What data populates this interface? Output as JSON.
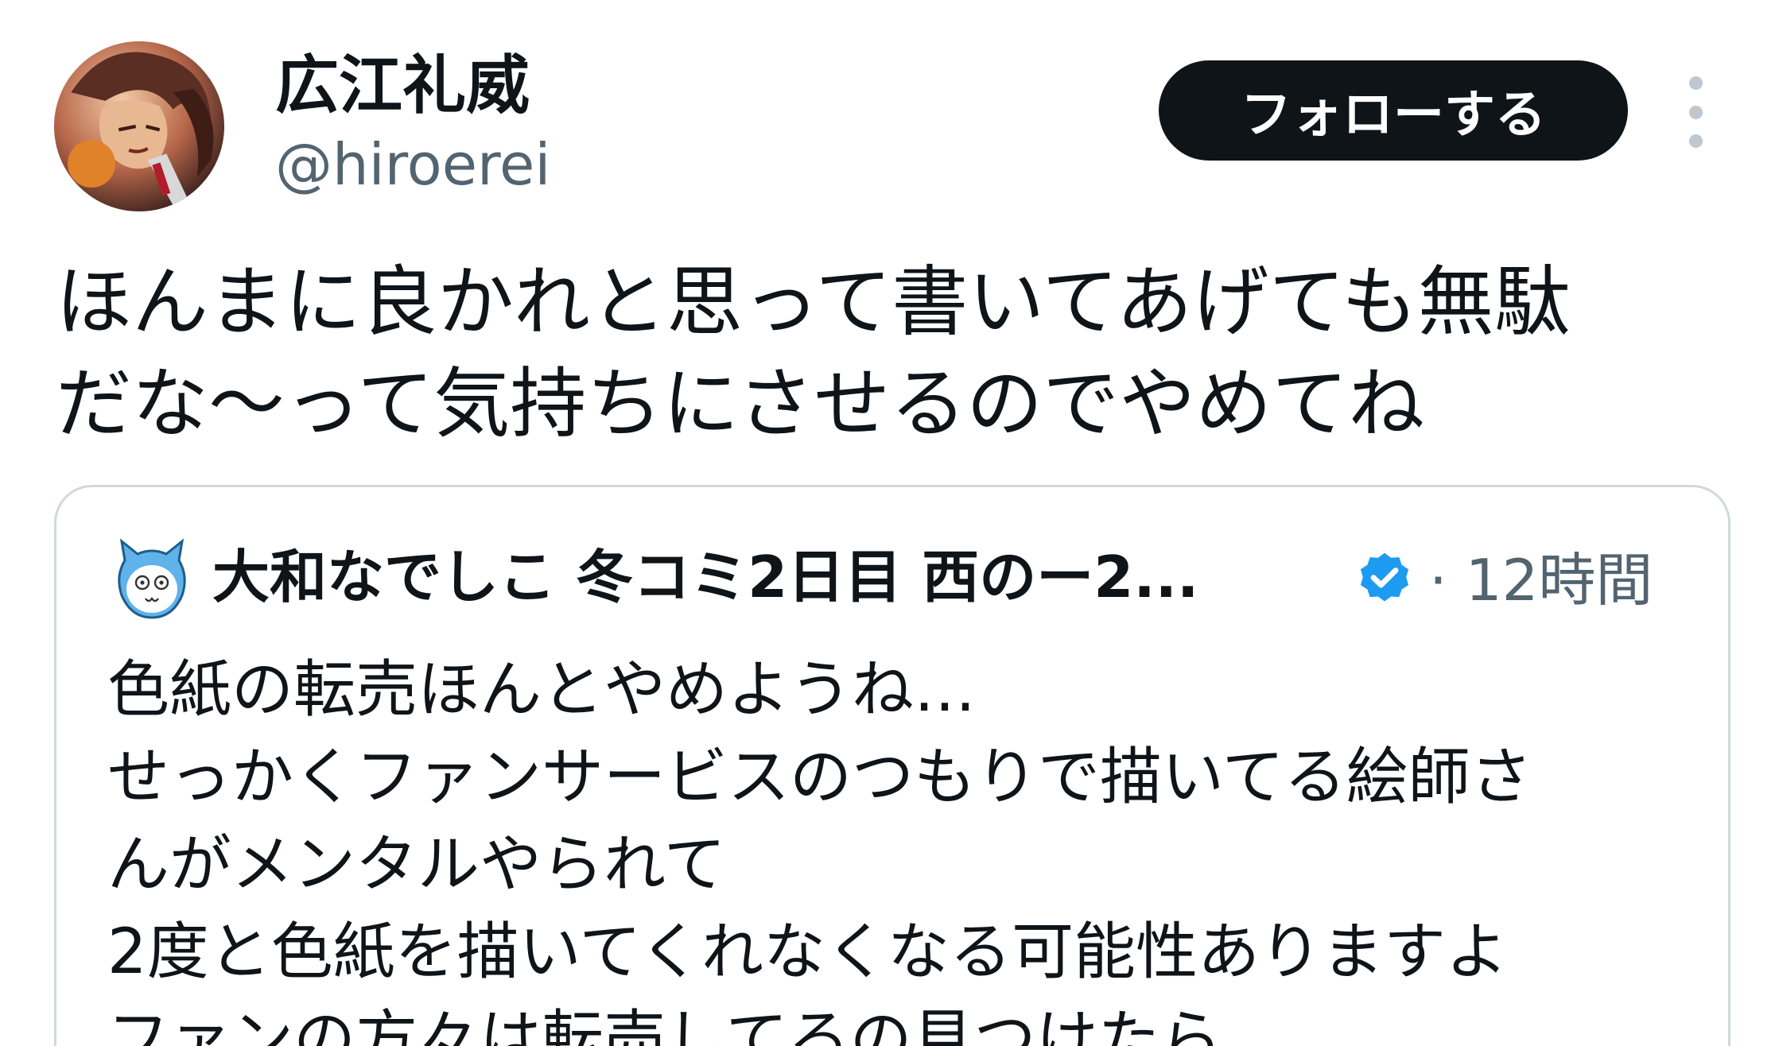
{
  "author": {
    "display_name": "広江礼威",
    "handle": "@hiroerei"
  },
  "actions": {
    "follow_label": "フォローする"
  },
  "tweet": {
    "lines": [
      "ほんまに良かれと思って書いてあげても無駄",
      "だな〜って気持ちにさせるのでやめてね"
    ]
  },
  "quoted_tweet": {
    "display_name": "大和なでしこ 冬コミ2日目 西のー2...",
    "time": "· 12時間",
    "verified": true,
    "lines": [
      "色紙の転売ほんとやめようね…",
      "せっかくファンサービスのつもりで描いてる絵師さ",
      "んがメンタルやられて",
      "2度と色紙を描いてくれなくなる可能性ありますよ",
      "ファンの方々は転売してるの見つけたら"
    ]
  },
  "colors": {
    "text_primary": "#0f1419",
    "text_secondary": "#536471",
    "border": "#cfd9de",
    "verified_blue": "#1d9bf0",
    "follow_button_bg": "#0f1419"
  }
}
